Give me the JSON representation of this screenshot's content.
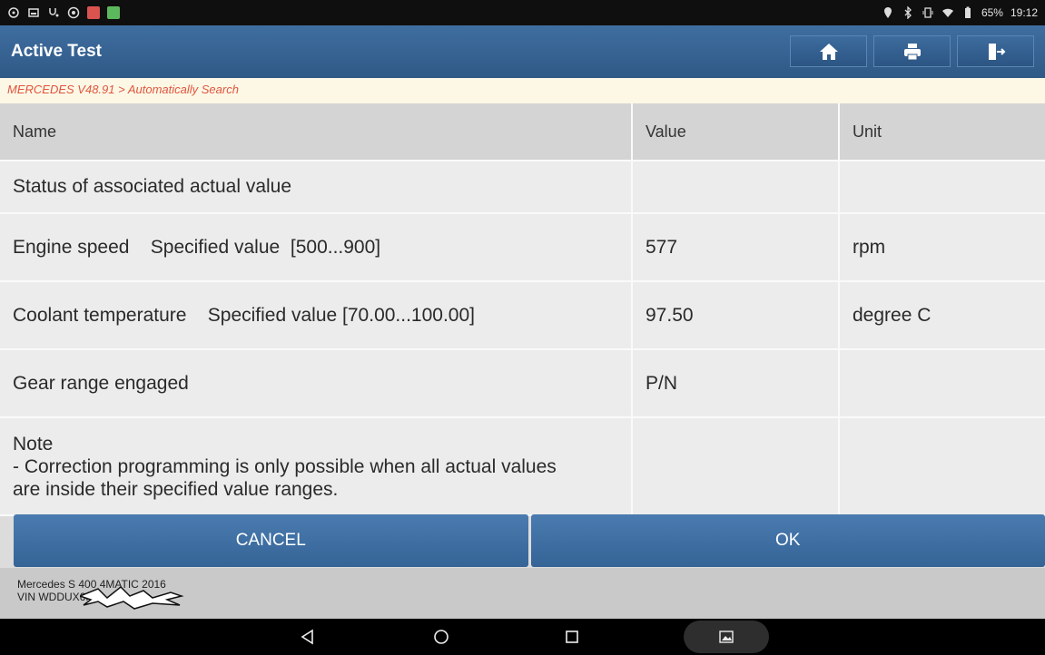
{
  "status_bar": {
    "battery": "65%",
    "time": "19:12",
    "app_colors": [
      "#e74c3c",
      "#2ecc71"
    ]
  },
  "header": {
    "title": "Active Test",
    "buttons": [
      {
        "name": "home-icon"
      },
      {
        "name": "print-icon"
      },
      {
        "name": "exit-icon"
      }
    ]
  },
  "breadcrumb": "MERCEDES V48.91 > Automatically Search",
  "table": {
    "columns": [
      "Name",
      "Value",
      "Unit"
    ],
    "rows": [
      {
        "name": "Status of associated actual value",
        "value": "",
        "unit": ""
      },
      {
        "name": "Engine speed    Specified value  [500...900]",
        "value": "577",
        "unit": "rpm"
      },
      {
        "name": "Coolant temperature    Specified value [70.00...100.00]",
        "value": "97.50",
        "unit": "degree C"
      },
      {
        "name": "Gear range engaged",
        "value": "P/N",
        "unit": ""
      },
      {
        "name_lines": [
          "Note",
          "- Correction programming is only possible when all actual values",
          "are inside their specified value ranges."
        ],
        "value": "",
        "unit": ""
      }
    ]
  },
  "actions": {
    "cancel": "CANCEL",
    "ok": "OK"
  },
  "footer": {
    "vehicle": "Mercedes S 400 4MATIC 2016",
    "vin": "VIN WDDUX6HB"
  },
  "colors": {
    "accent": "#2f5986",
    "breadcrumb_text": "#e0553d",
    "button": "#4a7bb0"
  }
}
